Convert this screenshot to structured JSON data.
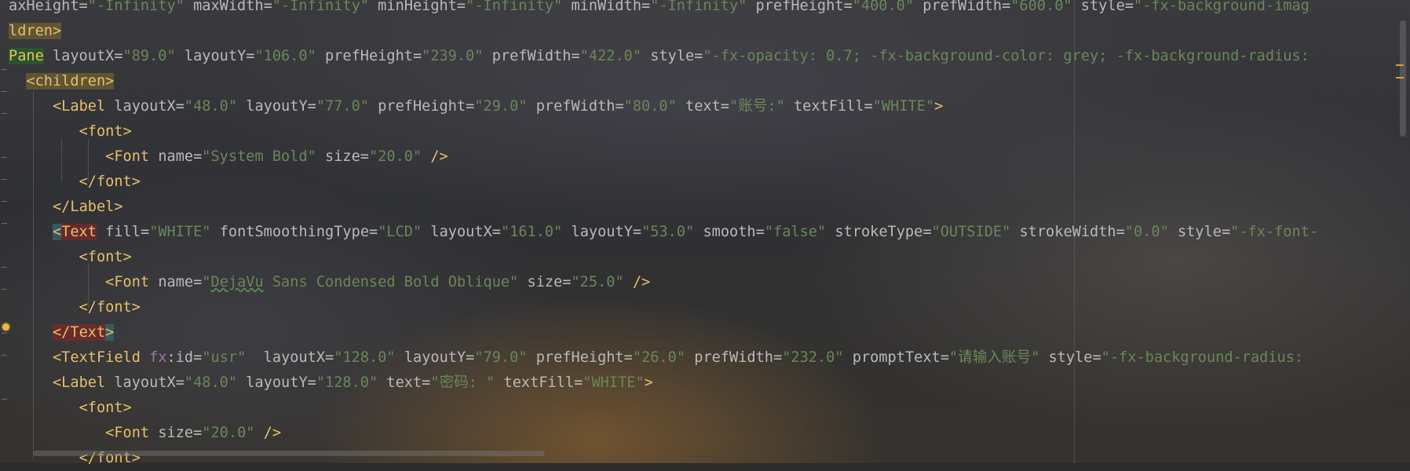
{
  "editor": {
    "lines": [
      [
        {
          "t": "axHeight=",
          "c": "att"
        },
        {
          "t": "\"-Infinity\"",
          "c": "val"
        },
        {
          "t": " maxWidth=",
          "c": "att"
        },
        {
          "t": "\"-Infinity\"",
          "c": "val"
        },
        {
          "t": " minHeight=",
          "c": "att"
        },
        {
          "t": "\"-Infinity\"",
          "c": "val"
        },
        {
          "t": " minWidth=",
          "c": "att"
        },
        {
          "t": "\"-Infinity\"",
          "c": "val"
        },
        {
          "t": " prefHeight=",
          "c": "att"
        },
        {
          "t": "\"400.0\"",
          "c": "val"
        },
        {
          "t": " prefWidth=",
          "c": "att"
        },
        {
          "t": "\"600.0\"",
          "c": "val"
        },
        {
          "t": " style=",
          "c": "att"
        },
        {
          "t": "\"-fx-background-imag",
          "c": "val"
        }
      ],
      [
        {
          "t": "ldren>",
          "c": "tag",
          "h": "hl-yellow"
        }
      ],
      [
        {
          "t": "Pane",
          "c": "tag",
          "h": "hl-green"
        },
        {
          "t": " layoutX=",
          "c": "att"
        },
        {
          "t": "\"89.0\"",
          "c": "val"
        },
        {
          "t": " layoutY=",
          "c": "att"
        },
        {
          "t": "\"106.0\"",
          "c": "val"
        },
        {
          "t": " prefHeight=",
          "c": "att"
        },
        {
          "t": "\"239.0\"",
          "c": "val"
        },
        {
          "t": " prefWidth=",
          "c": "att"
        },
        {
          "t": "\"422.0\"",
          "c": "val"
        },
        {
          "t": " style=",
          "c": "att"
        },
        {
          "t": "\"-fx-opacity: 0.7; -fx-background-color: grey; -fx-background-radius:",
          "c": "val"
        }
      ],
      [
        {
          "t": "  ",
          "c": "pl"
        },
        {
          "t": "<children>",
          "c": "tag",
          "h": "hl-yellow"
        }
      ],
      [
        {
          "t": "     ",
          "c": "pl"
        },
        {
          "t": "<Label",
          "c": "tag"
        },
        {
          "t": " layoutX=",
          "c": "att"
        },
        {
          "t": "\"48.0\"",
          "c": "val"
        },
        {
          "t": " layoutY=",
          "c": "att"
        },
        {
          "t": "\"77.0\"",
          "c": "val"
        },
        {
          "t": " prefHeight=",
          "c": "att"
        },
        {
          "t": "\"29.0\"",
          "c": "val"
        },
        {
          "t": " prefWidth=",
          "c": "att"
        },
        {
          "t": "\"80.0\"",
          "c": "val"
        },
        {
          "t": " text=",
          "c": "att"
        },
        {
          "t": "\"账号:\"",
          "c": "val"
        },
        {
          "t": " textFill=",
          "c": "att"
        },
        {
          "t": "\"WHITE\"",
          "c": "val"
        },
        {
          "t": ">",
          "c": "tag"
        }
      ],
      [
        {
          "t": "        ",
          "c": "pl"
        },
        {
          "t": "<font>",
          "c": "tag"
        }
      ],
      [
        {
          "t": "           ",
          "c": "pl"
        },
        {
          "t": "<Font",
          "c": "tag"
        },
        {
          "t": " name=",
          "c": "att"
        },
        {
          "t": "\"System Bold\"",
          "c": "val"
        },
        {
          "t": " size=",
          "c": "att"
        },
        {
          "t": "\"20.0\"",
          "c": "val"
        },
        {
          "t": " />",
          "c": "tag"
        }
      ],
      [
        {
          "t": "        ",
          "c": "pl"
        },
        {
          "t": "</font>",
          "c": "tag"
        }
      ],
      [
        {
          "t": "     ",
          "c": "pl"
        },
        {
          "t": "</Label>",
          "c": "tag"
        }
      ],
      [
        {
          "t": "     ",
          "c": "pl"
        },
        {
          "t": "<",
          "c": "tag",
          "h": "hl-cyan"
        },
        {
          "t": "Text",
          "c": "tag",
          "h": "hl-red"
        },
        {
          "t": " fill=",
          "c": "att"
        },
        {
          "t": "\"WHITE\"",
          "c": "val"
        },
        {
          "t": " fontSmoothingType=",
          "c": "att"
        },
        {
          "t": "\"LCD\"",
          "c": "val"
        },
        {
          "t": " layoutX=",
          "c": "att"
        },
        {
          "t": "\"161.0\"",
          "c": "val"
        },
        {
          "t": " layoutY=",
          "c": "att"
        },
        {
          "t": "\"53.0\"",
          "c": "val"
        },
        {
          "t": " smooth=",
          "c": "att"
        },
        {
          "t": "\"false\"",
          "c": "val"
        },
        {
          "t": " strokeType=",
          "c": "att"
        },
        {
          "t": "\"OUTSIDE\"",
          "c": "val"
        },
        {
          "t": " strokeWidth=",
          "c": "att"
        },
        {
          "t": "\"0.0\"",
          "c": "val"
        },
        {
          "t": " style=",
          "c": "att"
        },
        {
          "t": "\"-fx-font-",
          "c": "val"
        }
      ],
      [
        {
          "t": "        ",
          "c": "pl"
        },
        {
          "t": "<font>",
          "c": "tag"
        }
      ],
      [
        {
          "t": "           ",
          "c": "pl"
        },
        {
          "t": "<Font",
          "c": "tag"
        },
        {
          "t": " name=",
          "c": "att"
        },
        {
          "t": "\"",
          "c": "val"
        },
        {
          "t": "DejaVu",
          "c": "val",
          "s": "squig"
        },
        {
          "t": " Sans Condensed Bold Oblique\"",
          "c": "val"
        },
        {
          "t": " size=",
          "c": "att"
        },
        {
          "t": "\"25.0\"",
          "c": "val"
        },
        {
          "t": " />",
          "c": "tag"
        }
      ],
      [
        {
          "t": "        ",
          "c": "pl"
        },
        {
          "t": "</font>",
          "c": "tag"
        }
      ],
      [
        {
          "t": "     ",
          "c": "pl"
        },
        {
          "t": "</Text",
          "c": "tag",
          "h": "hl-red"
        },
        {
          "t": ">",
          "c": "tag",
          "h": "hl-cyan"
        }
      ],
      [
        {
          "t": "     ",
          "c": "pl"
        },
        {
          "t": "<TextField",
          "c": "tag"
        },
        {
          "t": " fx",
          "c": "ns"
        },
        {
          "t": ":id=",
          "c": "att"
        },
        {
          "t": "\"usr\"",
          "c": "val"
        },
        {
          "t": "  layoutX=",
          "c": "att"
        },
        {
          "t": "\"128.0\"",
          "c": "val"
        },
        {
          "t": " layoutY=",
          "c": "att"
        },
        {
          "t": "\"79.0\"",
          "c": "val"
        },
        {
          "t": " prefHeight=",
          "c": "att"
        },
        {
          "t": "\"26.0\"",
          "c": "val"
        },
        {
          "t": " prefWidth=",
          "c": "att"
        },
        {
          "t": "\"232.0\"",
          "c": "val"
        },
        {
          "t": " promptText=",
          "c": "att"
        },
        {
          "t": "\"请输入账号\"",
          "c": "val"
        },
        {
          "t": " style=",
          "c": "att"
        },
        {
          "t": "\"-fx-background-radius:",
          "c": "val"
        }
      ],
      [
        {
          "t": "     ",
          "c": "pl"
        },
        {
          "t": "<Label",
          "c": "tag"
        },
        {
          "t": " layoutX=",
          "c": "att"
        },
        {
          "t": "\"48.0\"",
          "c": "val"
        },
        {
          "t": " layoutY=",
          "c": "att"
        },
        {
          "t": "\"128.0\"",
          "c": "val"
        },
        {
          "t": " text=",
          "c": "att"
        },
        {
          "t": "\"密码: \"",
          "c": "val"
        },
        {
          "t": " textFill=",
          "c": "att"
        },
        {
          "t": "\"WHITE\"",
          "c": "val"
        },
        {
          "t": ">",
          "c": "tag"
        }
      ],
      [
        {
          "t": "        ",
          "c": "pl"
        },
        {
          "t": "<font>",
          "c": "tag"
        }
      ],
      [
        {
          "t": "           ",
          "c": "pl"
        },
        {
          "t": "<Font",
          "c": "tag"
        },
        {
          "t": " size=",
          "c": "att"
        },
        {
          "t": "\"20.0\"",
          "c": "val"
        },
        {
          "t": " />",
          "c": "tag"
        }
      ],
      [
        {
          "t": "        ",
          "c": "pl"
        },
        {
          "t": "</font>",
          "c": "tag"
        }
      ]
    ]
  },
  "colors": {
    "tag": "#e8bf6a",
    "attribute": "#bababa",
    "value": "#6a8759",
    "namespace": "#9876aa",
    "warning_bulb": "#e8b93a"
  },
  "icons": [
    "fold-marker-icon",
    "intention-bulb-icon"
  ]
}
